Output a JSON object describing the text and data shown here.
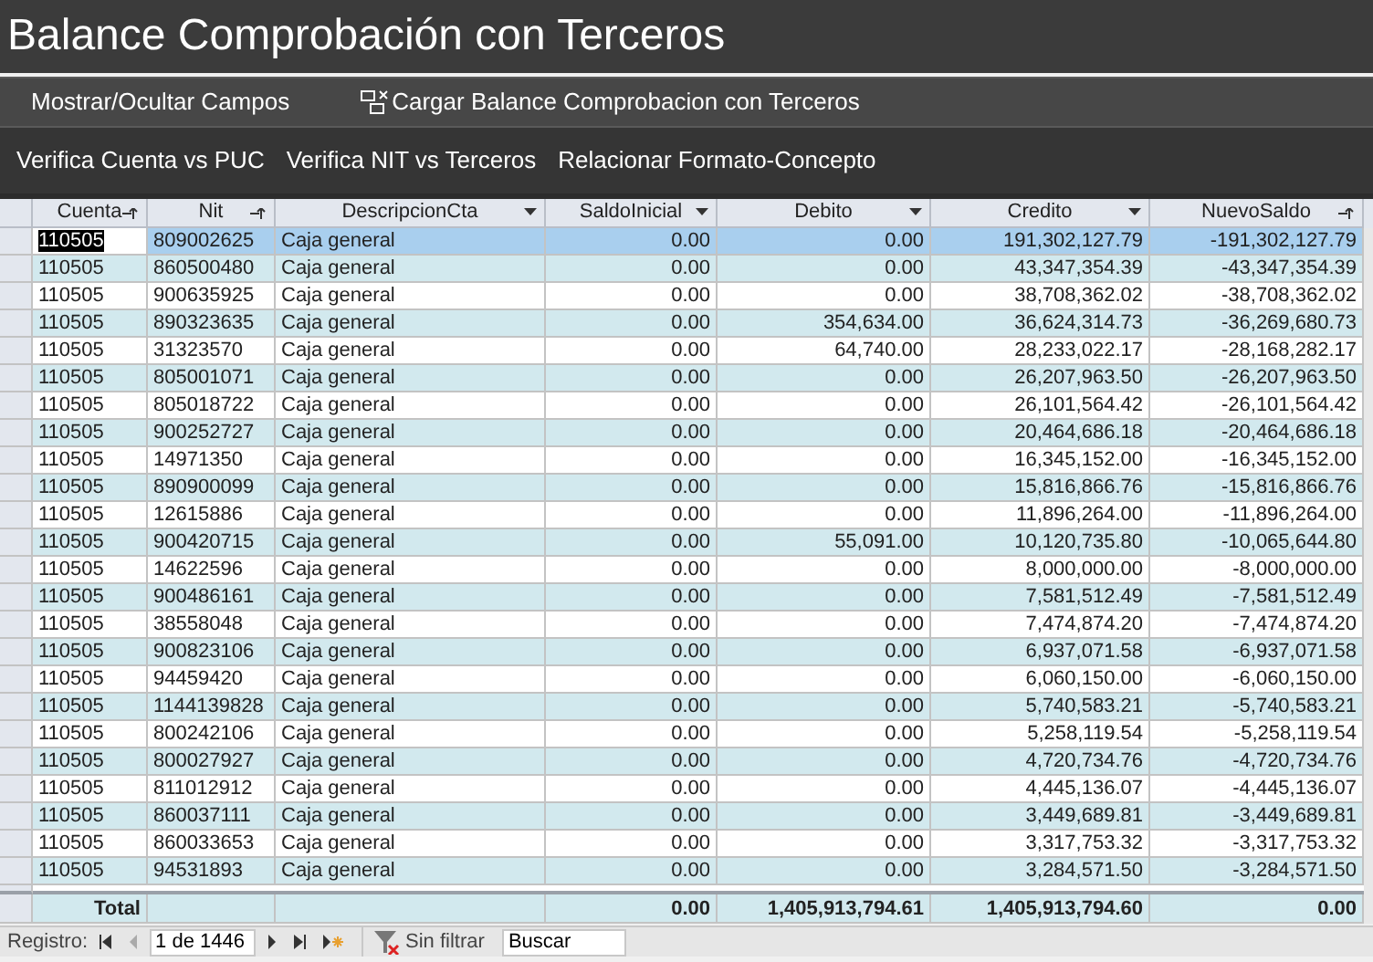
{
  "window": {
    "title": "Balance Comprobación con Terceros"
  },
  "menu": [
    {
      "label": "Mostrar/Ocultar Campos",
      "kind": "text"
    },
    {
      "label": "Cargar Balance Comprobacion con Terceros",
      "kind": "icon"
    }
  ],
  "toolbar": [
    "Verifica Cuenta vs PUC",
    "Verifica NIT vs Terceros",
    "Relacionar Formato-Concepto"
  ],
  "table": {
    "columns": [
      {
        "label": "Cuenta",
        "sorted": true
      },
      {
        "label": "Nit",
        "sorted": true
      },
      {
        "label": "DescripcionCta",
        "sorted": false
      },
      {
        "label": "SaldoInicial",
        "sorted": false
      },
      {
        "label": "Debito",
        "sorted": false
      },
      {
        "label": "Credito",
        "sorted": false
      },
      {
        "label": "NuevoSaldo",
        "sorted": true
      }
    ],
    "rows": [
      {
        "selected": true,
        "cells": [
          "110505",
          "809002625",
          "Caja general",
          "0.00",
          "0.00",
          "191,302,127.79",
          "-191,302,127.79"
        ]
      },
      {
        "selected": false,
        "cells": [
          "110505",
          "860500480",
          "Caja general",
          "0.00",
          "0.00",
          "43,347,354.39",
          "-43,347,354.39"
        ]
      },
      {
        "selected": false,
        "cells": [
          "110505",
          "900635925",
          "Caja general",
          "0.00",
          "0.00",
          "38,708,362.02",
          "-38,708,362.02"
        ]
      },
      {
        "selected": false,
        "cells": [
          "110505",
          "890323635",
          "Caja general",
          "0.00",
          "354,634.00",
          "36,624,314.73",
          "-36,269,680.73"
        ]
      },
      {
        "selected": false,
        "cells": [
          "110505",
          "31323570",
          "Caja general",
          "0.00",
          "64,740.00",
          "28,233,022.17",
          "-28,168,282.17"
        ]
      },
      {
        "selected": false,
        "cells": [
          "110505",
          "805001071",
          "Caja general",
          "0.00",
          "0.00",
          "26,207,963.50",
          "-26,207,963.50"
        ]
      },
      {
        "selected": false,
        "cells": [
          "110505",
          "805018722",
          "Caja general",
          "0.00",
          "0.00",
          "26,101,564.42",
          "-26,101,564.42"
        ]
      },
      {
        "selected": false,
        "cells": [
          "110505",
          "900252727",
          "Caja general",
          "0.00",
          "0.00",
          "20,464,686.18",
          "-20,464,686.18"
        ]
      },
      {
        "selected": false,
        "cells": [
          "110505",
          "14971350",
          "Caja general",
          "0.00",
          "0.00",
          "16,345,152.00",
          "-16,345,152.00"
        ]
      },
      {
        "selected": false,
        "cells": [
          "110505",
          "890900099",
          "Caja general",
          "0.00",
          "0.00",
          "15,816,866.76",
          "-15,816,866.76"
        ]
      },
      {
        "selected": false,
        "cells": [
          "110505",
          "12615886",
          "Caja general",
          "0.00",
          "0.00",
          "11,896,264.00",
          "-11,896,264.00"
        ]
      },
      {
        "selected": false,
        "cells": [
          "110505",
          "900420715",
          "Caja general",
          "0.00",
          "55,091.00",
          "10,120,735.80",
          "-10,065,644.80"
        ]
      },
      {
        "selected": false,
        "cells": [
          "110505",
          "14622596",
          "Caja general",
          "0.00",
          "0.00",
          "8,000,000.00",
          "-8,000,000.00"
        ]
      },
      {
        "selected": false,
        "cells": [
          "110505",
          "900486161",
          "Caja general",
          "0.00",
          "0.00",
          "7,581,512.49",
          "-7,581,512.49"
        ]
      },
      {
        "selected": false,
        "cells": [
          "110505",
          "38558048",
          "Caja general",
          "0.00",
          "0.00",
          "7,474,874.20",
          "-7,474,874.20"
        ]
      },
      {
        "selected": false,
        "cells": [
          "110505",
          "900823106",
          "Caja general",
          "0.00",
          "0.00",
          "6,937,071.58",
          "-6,937,071.58"
        ]
      },
      {
        "selected": false,
        "cells": [
          "110505",
          "94459420",
          "Caja general",
          "0.00",
          "0.00",
          "6,060,150.00",
          "-6,060,150.00"
        ]
      },
      {
        "selected": false,
        "cells": [
          "110505",
          "1144139828",
          "Caja general",
          "0.00",
          "0.00",
          "5,740,583.21",
          "-5,740,583.21"
        ]
      },
      {
        "selected": false,
        "cells": [
          "110505",
          "800242106",
          "Caja general",
          "0.00",
          "0.00",
          "5,258,119.54",
          "-5,258,119.54"
        ]
      },
      {
        "selected": false,
        "cells": [
          "110505",
          "800027927",
          "Caja general",
          "0.00",
          "0.00",
          "4,720,734.76",
          "-4,720,734.76"
        ]
      },
      {
        "selected": false,
        "cells": [
          "110505",
          "811012912",
          "Caja general",
          "0.00",
          "0.00",
          "4,445,136.07",
          "-4,445,136.07"
        ]
      },
      {
        "selected": false,
        "cells": [
          "110505",
          "860037111",
          "Caja general",
          "0.00",
          "0.00",
          "3,449,689.81",
          "-3,449,689.81"
        ]
      },
      {
        "selected": false,
        "cells": [
          "110505",
          "860033653",
          "Caja general",
          "0.00",
          "0.00",
          "3,317,753.32",
          "-3,317,753.32"
        ]
      },
      {
        "selected": false,
        "cells": [
          "110505",
          "94531893",
          "Caja general",
          "0.00",
          "0.00",
          "3,284,571.50",
          "-3,284,571.50"
        ]
      }
    ],
    "total": {
      "label": "Total",
      "values": [
        "0.00",
        "1,405,913,794.61",
        "1,405,913,794.60",
        "0.00"
      ]
    }
  },
  "navigation": {
    "label": "Registro:",
    "position": "1 de 1446",
    "filter": "Sin filtrar",
    "search": {
      "placeholder": "Buscar"
    }
  }
}
